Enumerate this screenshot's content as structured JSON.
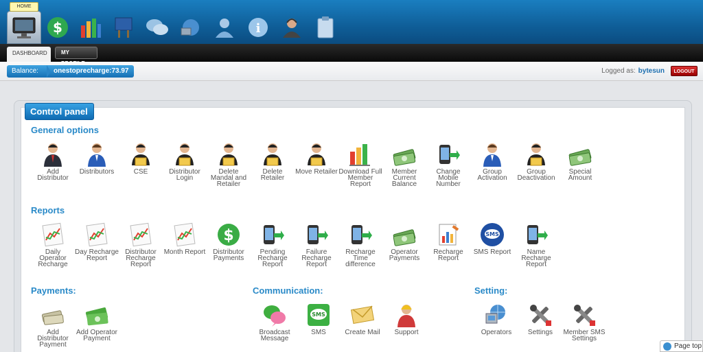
{
  "header": {
    "home_tooltip": "HOME",
    "icons": [
      "monitor-icon",
      "dollar-icon",
      "bar-chart-icon",
      "sign-board-icon",
      "chat-icon",
      "globe-network-icon",
      "user-icon",
      "info-icon",
      "support-agent-icon",
      "clipboard-icon"
    ]
  },
  "nav": {
    "tabs": [
      {
        "label": "DASHBOARD"
      },
      {
        "label": "MY PROFILE"
      }
    ]
  },
  "balance": {
    "label": "Balance:",
    "value": "onestoprecharge:73.97"
  },
  "user": {
    "logged_label": "Logged as:",
    "username": "bytesun",
    "logout": "LOGOUT"
  },
  "panel": {
    "title": "Control panel"
  },
  "sections": {
    "general": {
      "title": "General options",
      "items": [
        {
          "label": "Add Distributor",
          "icon": "business-man-icon"
        },
        {
          "label": "Distributors",
          "icon": "user-blue-icon"
        },
        {
          "label": "CSE",
          "icon": "user-laptop-icon"
        },
        {
          "label": "Distributor Login",
          "icon": "user-laptop-icon"
        },
        {
          "label": "Delete Mandal and Retailer",
          "icon": "user-laptop-icon"
        },
        {
          "label": "Delete Retailer",
          "icon": "user-laptop-icon"
        },
        {
          "label": "Move Retailer",
          "icon": "user-laptop-icon"
        },
        {
          "label": "Download Full Member Report",
          "icon": "bar-chart-icon"
        },
        {
          "label": "Member Current Balance",
          "icon": "cash-icon"
        },
        {
          "label": "Change Mobile Number",
          "icon": "mobile-arrow-icon"
        },
        {
          "label": "Group Activation",
          "icon": "user-blue-icon"
        },
        {
          "label": "Group Deactivation",
          "icon": "user-laptop-icon"
        },
        {
          "label": "Special Amount",
          "icon": "cash-icon"
        }
      ]
    },
    "reports": {
      "title": "Reports",
      "items": [
        {
          "label": "Daily Operator Recharge",
          "icon": "line-chart-icon"
        },
        {
          "label": "Day Recharge Report",
          "icon": "line-chart-icon"
        },
        {
          "label": "Distributor Recharge Report",
          "icon": "line-chart-icon"
        },
        {
          "label": "Month Report",
          "icon": "line-chart-icon"
        },
        {
          "label": "Distributor Payments",
          "icon": "dollar-icon"
        },
        {
          "label": "Pending Recharge Report",
          "icon": "mobile-arrow-icon"
        },
        {
          "label": "Failure Recharge Report",
          "icon": "mobile-arrow-icon"
        },
        {
          "label": "Recharge Time difference",
          "icon": "mobile-arrow-icon"
        },
        {
          "label": "Operator Payments",
          "icon": "cash-icon"
        },
        {
          "label": "Recharge Report",
          "icon": "report-chart-icon"
        },
        {
          "label": "SMS Report",
          "icon": "sms-bubble-icon"
        },
        {
          "label": "Name Recharge Report",
          "icon": "mobile-arrow-icon"
        }
      ]
    },
    "payments": {
      "title": "Payments:",
      "items": [
        {
          "label": "Add Distributor Payment",
          "icon": "cash-stack-icon"
        },
        {
          "label": "Add Operator Payment",
          "icon": "green-cash-icon"
        }
      ]
    },
    "communication": {
      "title": "Communication:",
      "items": [
        {
          "label": "Broadcast Message",
          "icon": "chat-bubbles-icon"
        },
        {
          "label": "SMS",
          "icon": "sms-icon"
        },
        {
          "label": "Create Mail",
          "icon": "envelope-icon"
        },
        {
          "label": "Support",
          "icon": "support-agent-icon"
        }
      ]
    },
    "setting": {
      "title": "Setting:",
      "items": [
        {
          "label": "Operators",
          "icon": "globe-network-icon"
        },
        {
          "label": "Settings",
          "icon": "tools-icon"
        },
        {
          "label": "Member SMS Settings",
          "icon": "tools-icon"
        }
      ]
    }
  },
  "footer": {
    "page_top": "Page top"
  }
}
